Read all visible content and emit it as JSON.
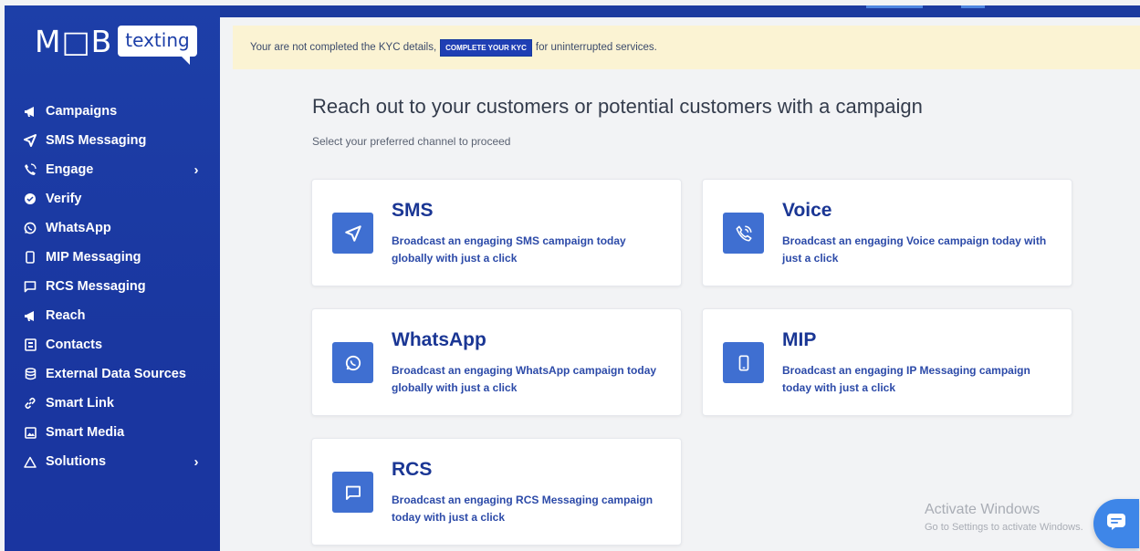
{
  "logo": {
    "mob": "M□B",
    "texting": "texting"
  },
  "sidebar": {
    "items": [
      {
        "label": "Campaigns",
        "icon": "megaphone-icon",
        "has_submenu": false
      },
      {
        "label": "SMS Messaging",
        "icon": "send-icon",
        "has_submenu": false
      },
      {
        "label": "Engage",
        "icon": "phone-call-icon",
        "has_submenu": true
      },
      {
        "label": "Verify",
        "icon": "badge-check-icon",
        "has_submenu": false
      },
      {
        "label": "WhatsApp",
        "icon": "whatsapp-icon",
        "has_submenu": false
      },
      {
        "label": "MIP Messaging",
        "icon": "mobile-icon",
        "has_submenu": false
      },
      {
        "label": "RCS Messaging",
        "icon": "chat-bubble-icon",
        "has_submenu": false
      },
      {
        "label": "Reach",
        "icon": "megaphone-icon",
        "has_submenu": false
      },
      {
        "label": "Contacts",
        "icon": "contact-card-icon",
        "has_submenu": false
      },
      {
        "label": "External Data Sources",
        "icon": "database-icon",
        "has_submenu": false
      },
      {
        "label": "Smart Link",
        "icon": "link-icon",
        "has_submenu": false
      },
      {
        "label": "Smart Media",
        "icon": "image-icon",
        "has_submenu": false
      },
      {
        "label": "Solutions",
        "icon": "warning-triangle-icon",
        "has_submenu": true
      }
    ],
    "chevron": "›"
  },
  "kyc": {
    "text_before": "Your are not completed the KYC details,",
    "button_label": "COMPLETE YOUR KYC",
    "text_after": "for uninterrupted services."
  },
  "main": {
    "heading": "Reach out to your customers or potential customers with a campaign",
    "subheading": "Select your preferred channel to proceed",
    "channels": [
      {
        "title": "SMS",
        "description": "Broadcast an engaging SMS campaign today globally with just a click",
        "icon": "send-icon"
      },
      {
        "title": "Voice",
        "description": "Broadcast an engaging Voice campaign today with just a click",
        "icon": "phone-call-icon"
      },
      {
        "title": "WhatsApp",
        "description": "Broadcast an engaging WhatsApp campaign today globally with just a click",
        "icon": "whatsapp-icon"
      },
      {
        "title": "MIP",
        "description": "Broadcast an engaging IP Messaging campaign today with just a click",
        "icon": "mobile-icon"
      },
      {
        "title": "RCS",
        "description": "Broadcast an engaging RCS Messaging campaign today with just a click",
        "icon": "chat-bubble-icon"
      }
    ]
  },
  "watermark": {
    "line1": "Activate Windows",
    "line2": "Go to Settings to activate Windows."
  },
  "chat_widget": {
    "icon": "chat-icon"
  },
  "colors": {
    "sidebar": "#1d3fa8",
    "accent": "#3f6fd1",
    "banner": "#fbf3d3",
    "title": "#1a3694"
  }
}
